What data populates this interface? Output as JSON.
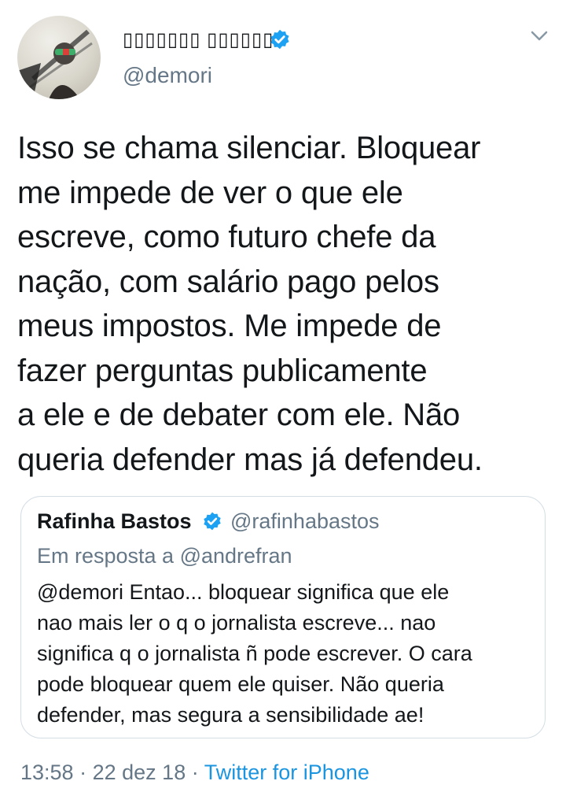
{
  "tweet": {
    "display_name": "▯▯▯▯▯▯▯ ▯▯▯▯▯▯",
    "handle": "@demori",
    "text": "Isso se chama silenciar. Bloquear\nme impede de ver o que ele\nescreve, como futuro chefe da\nnação, com salário pago pelos\nmeus impostos. Me impede de\nfazer perguntas publicamente\na ele e de debater com ele. Não\nqueria defender mas já defendeu.",
    "time": "13:58",
    "separator": "·",
    "date": "22 dez 18",
    "source": "Twitter for iPhone"
  },
  "quote": {
    "name": "Rafinha Bastos",
    "handle": "@rafinhabastos",
    "reply_to": "Em resposta a @andrefran",
    "text": "@demori Entao... bloquear significa que ele\nnao mais ler o q o jornalista escreve... nao\nsignifica q o jornalista ñ pode escrever. O cara\npode bloquear quem ele quiser. Não queria\ndefender, mas segura a sensibilidade ae!"
  },
  "icons": {
    "avatar": "avatar-image",
    "verified": "verified-badge-icon",
    "menu": "chevron-down-icon"
  },
  "colors": {
    "text": "#14171a",
    "secondary": "#657786",
    "link": "#1b95e0",
    "verified": "#1da1f2",
    "border": "#d3dde4"
  }
}
